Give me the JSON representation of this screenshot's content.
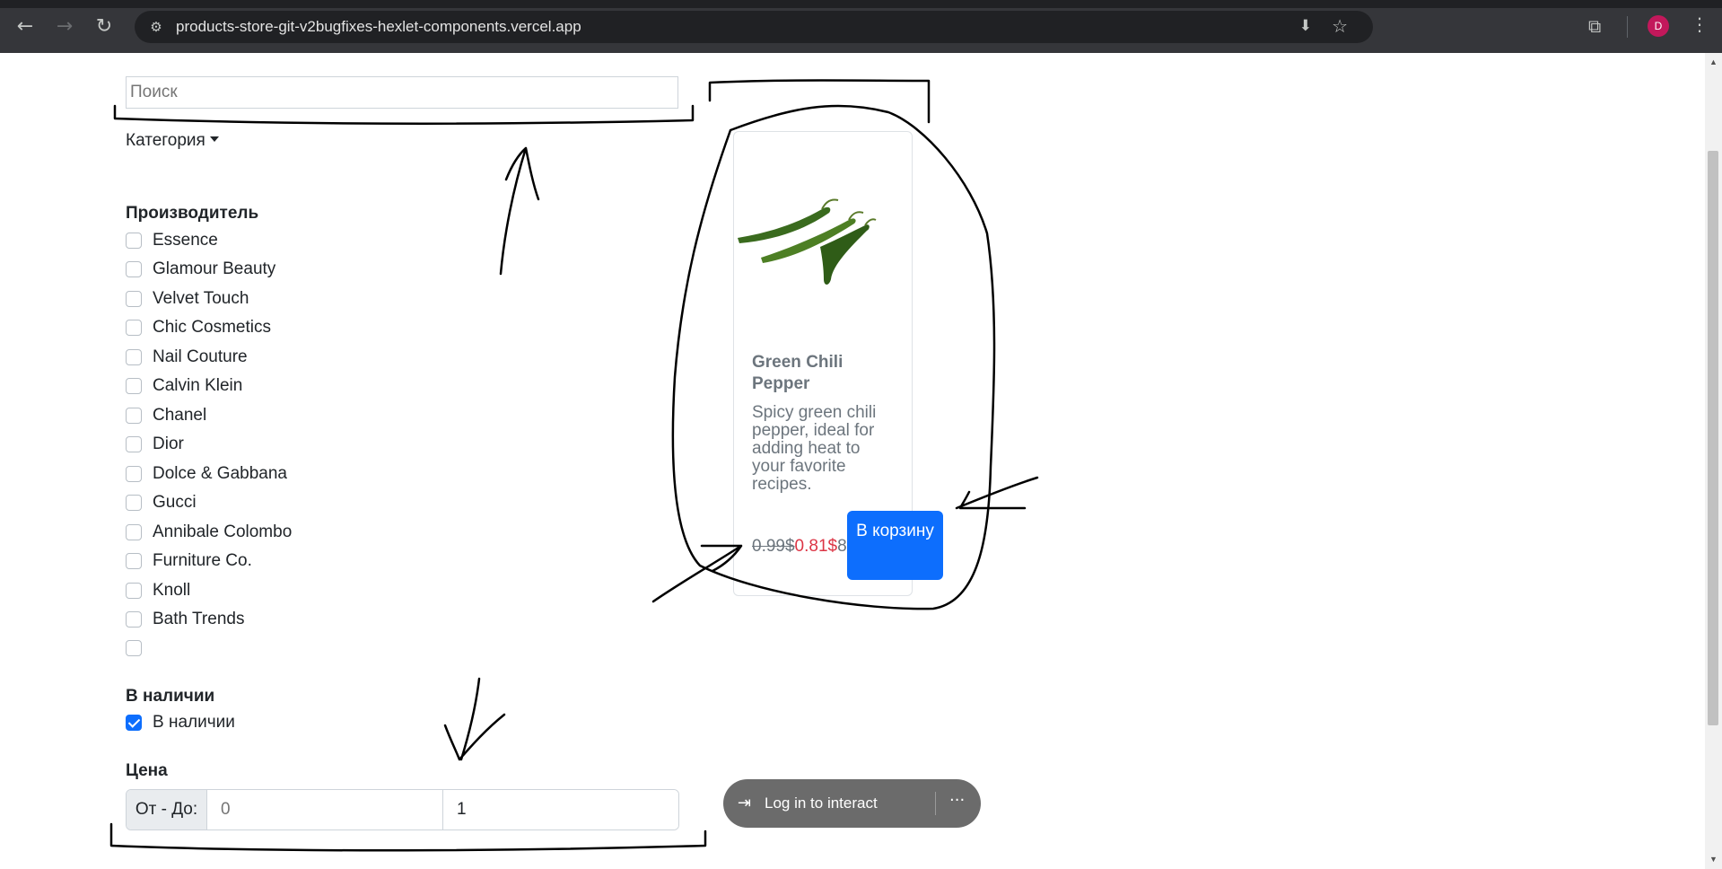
{
  "browser": {
    "url": "products-store-git-v2bugfixes-hexlet-components.vercel.app",
    "avatar_letter": "D"
  },
  "search": {
    "placeholder": "Поиск"
  },
  "filters": {
    "category_label": "Категория",
    "manufacturer_heading": "Производитель",
    "manufacturers": [
      "Essence",
      "Glamour Beauty",
      "Velvet Touch",
      "Chic Cosmetics",
      "Nail Couture",
      "Calvin Klein",
      "Chanel",
      "Dior",
      "Dolce & Gabbana",
      "Gucci",
      "Annibale Colombo",
      "Furniture Co.",
      "Knoll",
      "Bath Trends",
      ""
    ],
    "stock_heading": "В наличии",
    "stock_label": "В наличии",
    "stock_checked": true,
    "price_heading": "Цена",
    "price_prefix": "От - До:",
    "price_from_placeholder": "0",
    "price_to_value": "1"
  },
  "product": {
    "title": "Green Chili Pepper",
    "description": "Spicy green chili pepper, ideal for adding heat to your favorite recipes.",
    "old_price": "0.99$",
    "new_price": "0.81$",
    "extra_price": "8",
    "button_label": "В корзину",
    "image": "green-chili-peppers"
  },
  "overlay": {
    "login_label": "Log in to interact",
    "more_label": "···"
  },
  "colors": {
    "primary": "#0d6efd",
    "sale": "#dc3545",
    "muted": "#6c757d"
  }
}
